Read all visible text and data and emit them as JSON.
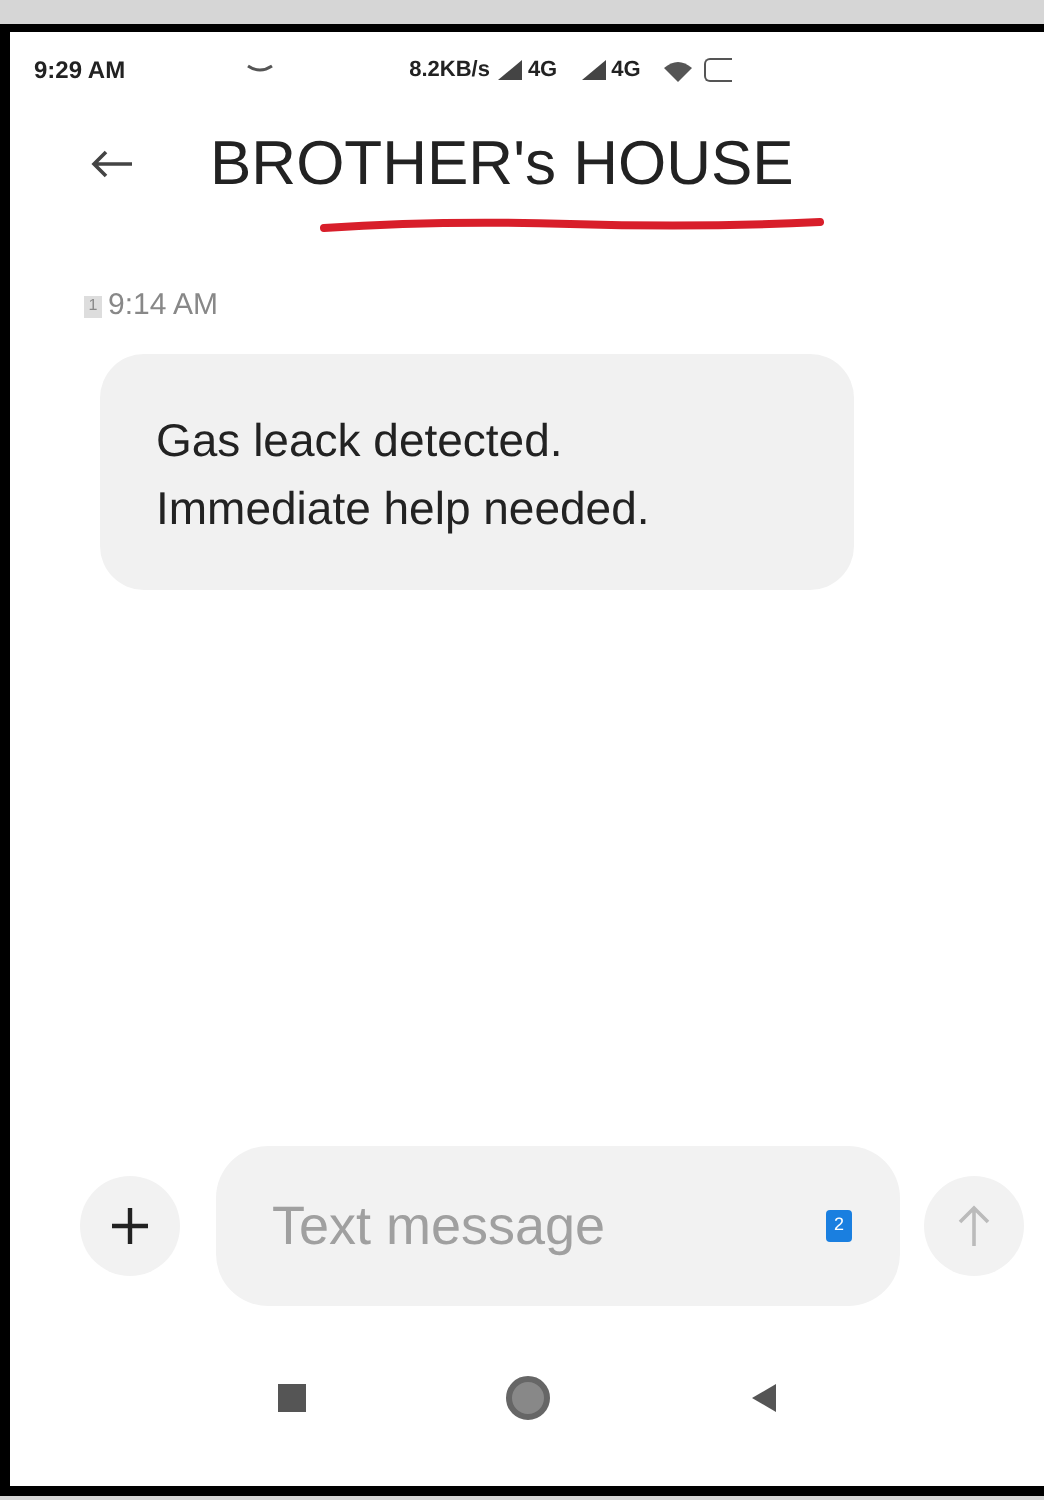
{
  "status_bar": {
    "time": "9:29 AM",
    "speed": "8.2KB/s",
    "network_1": "4G",
    "network_2": "4G"
  },
  "header": {
    "title": "BROTHER's HOUSE",
    "subtitle_redacted": true
  },
  "messages": [
    {
      "sim": "1",
      "time": "9:14 AM",
      "text": "Gas leack detected. Immediate help needed."
    }
  ],
  "composer": {
    "placeholder": "Text message",
    "sim_badge": "2"
  }
}
